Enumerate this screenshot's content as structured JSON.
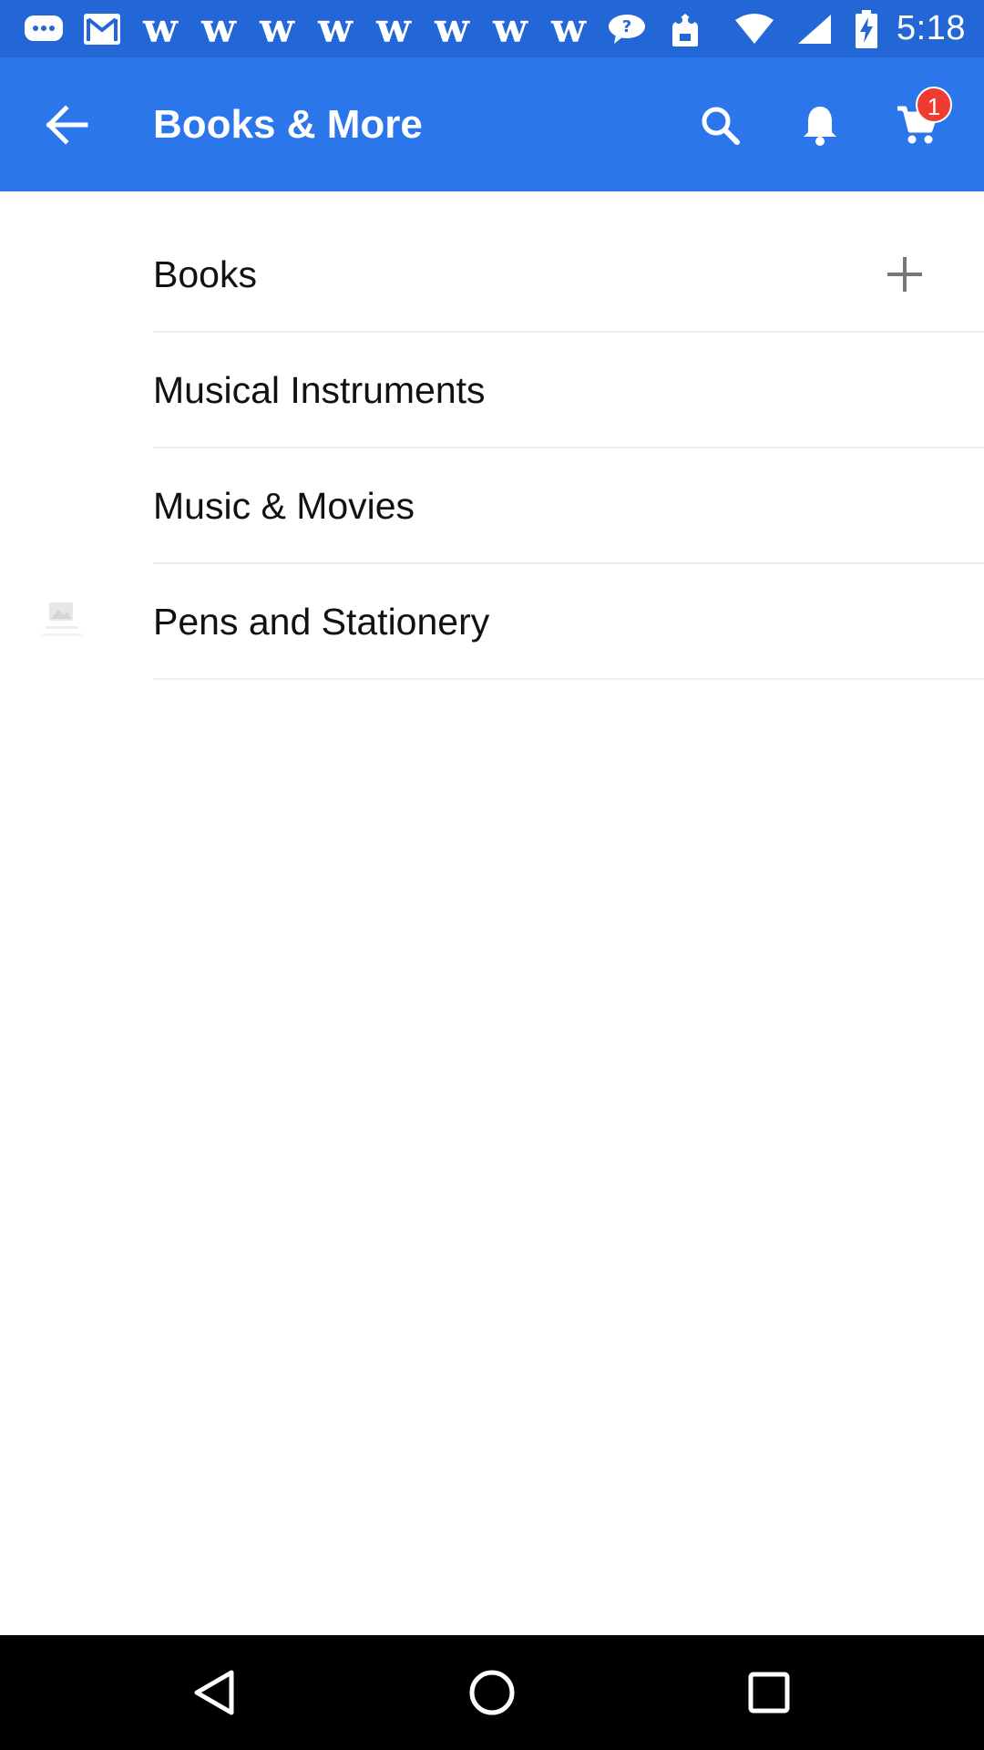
{
  "status_bar": {
    "time": "5:18",
    "notif_icons": [
      "messages-icon",
      "gmail-icon",
      "w-app-icon",
      "w-app-icon",
      "w-app-icon",
      "w-app-icon",
      "w-app-icon",
      "w-app-icon",
      "w-app-icon",
      "w-app-icon",
      "chat-bubble-icon",
      "box-app-icon"
    ],
    "w_glyph": "w",
    "system_icons": [
      "wifi-icon",
      "signal-icon",
      "battery-charging-icon"
    ]
  },
  "app_bar": {
    "title": "Books & More",
    "cart_count": "1",
    "background": "#2b76eb"
  },
  "categories": [
    {
      "label": "Books",
      "expandable": true
    },
    {
      "label": "Musical Instruments",
      "expandable": false
    },
    {
      "label": "Music & Movies",
      "expandable": false
    },
    {
      "label": "Pens and Stationery",
      "expandable": false,
      "has_thumbnail": true
    }
  ],
  "colors": {
    "status_bar": "#2366d6",
    "badge": "#ef3b32",
    "text": "#111111",
    "divider": "#ececec"
  }
}
